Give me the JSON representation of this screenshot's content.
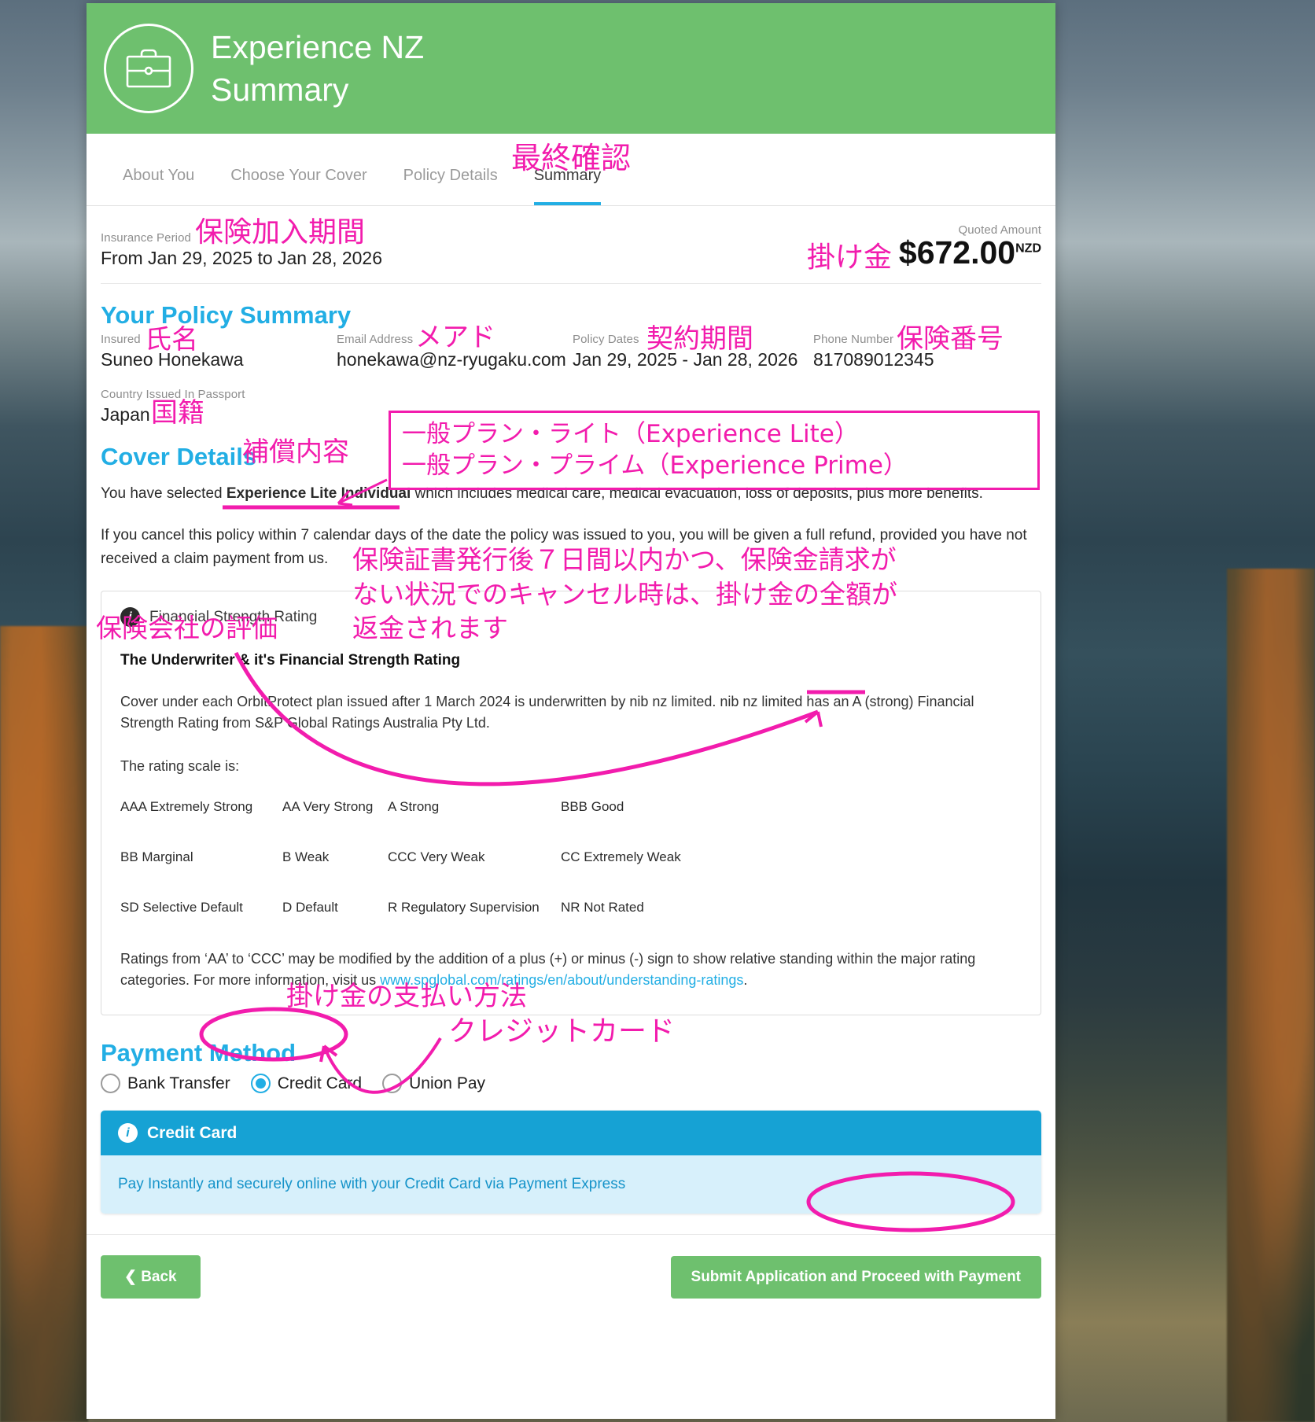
{
  "header": {
    "title_line1": "Experience NZ",
    "title_line2": "Summary",
    "logo_icon": "briefcase-icon"
  },
  "tabs": [
    {
      "label": "About You",
      "active": false
    },
    {
      "label": "Choose Your Cover",
      "active": false
    },
    {
      "label": "Policy Details",
      "active": false
    },
    {
      "label": "Summary",
      "active": true
    }
  ],
  "insurance_period": {
    "label": "Insurance Period",
    "value": "From Jan 29, 2025 to Jan 28, 2026"
  },
  "quote": {
    "label": "Quoted Amount",
    "amount": "$672.00",
    "currency": "NZD"
  },
  "policy_summary": {
    "heading": "Your Policy Summary",
    "fields": [
      {
        "label": "Insured",
        "value": "Suneo Honekawa"
      },
      {
        "label": "Email Address",
        "value": "honekawa@nz-ryugaku.com"
      },
      {
        "label": "Policy Dates",
        "value": "Jan 29, 2025 - Jan 28, 2026"
      },
      {
        "label": "Phone Number",
        "value": "817089012345"
      },
      {
        "label": "Country Issued In Passport",
        "value": "Japan"
      }
    ]
  },
  "cover_details": {
    "heading": "Cover Details",
    "selected_prefix": "You have selected ",
    "selected_plan": "Experience Lite Individual",
    "selected_suffix": " which includes medical care, medical evacuation, loss of deposits, plus more benefits.",
    "cancellation": "If you cancel this policy within 7 calendar days of the date the policy was issued to you, you will be given a full refund, provided you have not received a claim payment from us."
  },
  "financial_strength": {
    "panel_title": "Financial Strength Rating",
    "panel_icon": "info-icon",
    "subtitle": "The Underwriter & it's Financial Strength Rating",
    "paragraph": "Cover under each OrbitProtect plan issued after 1 March 2024 is underwritten by nib nz limited. nib nz limited has an A (strong) Financial Strength Rating from S&P Global Ratings Australia Pty Ltd.",
    "scale_intro": "The rating scale is:",
    "ratings": [
      "AAA Extremely Strong",
      "AA Very Strong",
      "A Strong",
      "BBB Good",
      "BB Marginal",
      "B Weak",
      "CCC Very Weak",
      "CC Extremely Weak",
      "SD Selective Default",
      "D Default",
      "R Regulatory Supervision",
      "NR Not Rated"
    ],
    "footnote_pre": "Ratings from ‘AA’ to ‘CCC’ may be modified by the addition of a plus (+) or minus (-) sign to show relative standing within the major rating categories. For more information, visit us ",
    "footnote_link": "www.spglobal.com/ratings/en/about/understanding-ratings",
    "footnote_post": "."
  },
  "payment": {
    "heading": "Payment Method",
    "options": [
      {
        "label": "Bank Transfer",
        "selected": false
      },
      {
        "label": "Credit Card",
        "selected": true
      },
      {
        "label": "Union Pay",
        "selected": false
      }
    ],
    "panel_title": "Credit Card",
    "panel_icon": "info-icon",
    "panel_body": "Pay Instantly and securely online with your Credit Card via Payment Express"
  },
  "footer": {
    "back_label": "Back",
    "back_icon": "chevron-left-icon",
    "submit_label": "Submit Application and Proceed with Payment"
  },
  "annotations": {
    "color": "#f21cad",
    "notes": [
      {
        "id": "final-check",
        "text": "最終確認"
      },
      {
        "id": "insurance-period",
        "text": "保険加入期間"
      },
      {
        "id": "premium",
        "text": "掛け金"
      },
      {
        "id": "name",
        "text": "氏名"
      },
      {
        "id": "email",
        "text": "メアド"
      },
      {
        "id": "contract-period",
        "text": "契約期間"
      },
      {
        "id": "policy-number",
        "text": "保険番号"
      },
      {
        "id": "nationality",
        "text": "国籍"
      },
      {
        "id": "cover-content",
        "text": "補償内容"
      },
      {
        "id": "plan-box-line1",
        "text": "一般プラン・ライト（Experience Lite）"
      },
      {
        "id": "plan-box-line2",
        "text": "一般プラン・プライム（Experience Prime）"
      },
      {
        "id": "refund-line1",
        "text": "保険証書発行後７日間以内かつ、保険金請求が"
      },
      {
        "id": "refund-line2",
        "text": "ない状況でのキャンセル時は、掛け金の全額が"
      },
      {
        "id": "refund-line3",
        "text": "返金されます"
      },
      {
        "id": "insurer-rating",
        "text": "保険会社の評価"
      },
      {
        "id": "payment-method",
        "text": "掛け金の支払い方法"
      },
      {
        "id": "credit-card",
        "text": "クレジットカード"
      }
    ]
  }
}
